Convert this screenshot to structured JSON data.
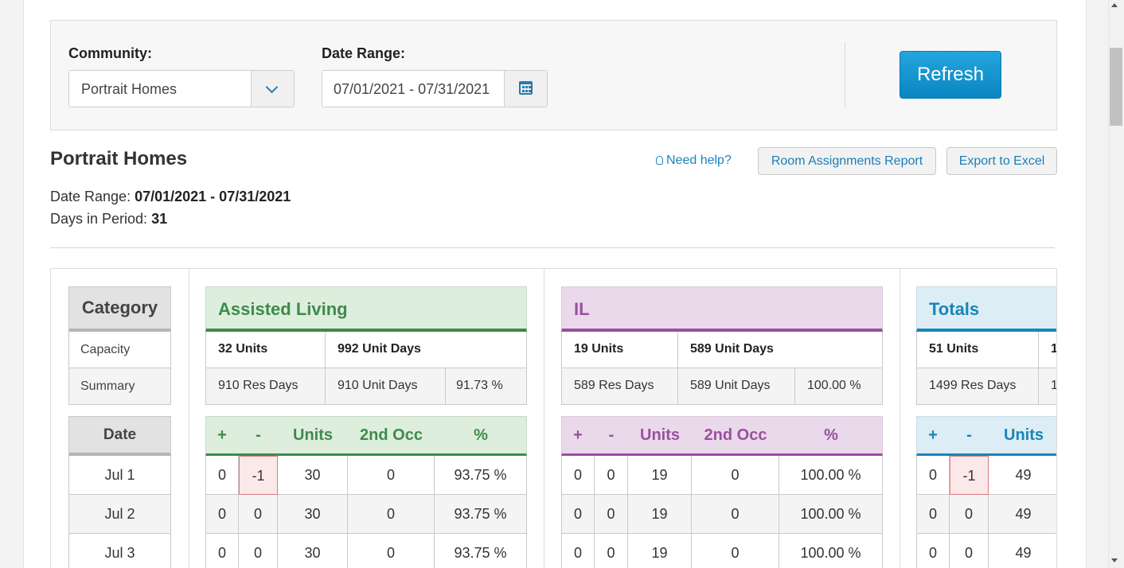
{
  "colors": {
    "accent": "#0b86c2",
    "al_green": "#3f8a4c",
    "il_purple": "#9a4fa0",
    "totals_teal": "#1a85b8",
    "negative_bg": "#fbe9ea"
  },
  "filters": {
    "community_label": "Community:",
    "community_value": "Portrait Homes",
    "date_range_label": "Date Range:",
    "date_range_value": "07/01/2021 - 07/31/2021",
    "refresh_label": "Refresh"
  },
  "header": {
    "title": "Portrait Homes",
    "help_link": "Need help?",
    "room_assignments_button": "Room Assignments Report",
    "export_button": "Export to Excel",
    "date_range_label": "Date Range:",
    "date_range_value": "07/01/2021 - 07/31/2021",
    "days_label": "Days in Period:",
    "days_value": "31"
  },
  "category": {
    "head": "Category",
    "rows": [
      "Capacity",
      "Summary"
    ],
    "date_head": "Date",
    "dates": [
      "Jul 1",
      "Jul 2",
      "Jul 3"
    ]
  },
  "sections": [
    {
      "title": "Assisted Living",
      "capacity_units": "32 Units",
      "capacity_unit_days": "992 Unit Days",
      "summary_res_days": "910 Res Days",
      "summary_unit_days": "910 Unit Days",
      "summary_pct": "91.73 %",
      "columns": [
        "+",
        "-",
        "Units",
        "2nd Occ",
        "%"
      ],
      "rows": [
        [
          "0",
          "-1",
          "30",
          "0",
          "93.75 %"
        ],
        [
          "0",
          "0",
          "30",
          "0",
          "93.75 %"
        ],
        [
          "0",
          "0",
          "30",
          "0",
          "93.75 %"
        ]
      ]
    },
    {
      "title": "IL",
      "capacity_units": "19 Units",
      "capacity_unit_days": "589 Unit Days",
      "summary_res_days": "589 Res Days",
      "summary_unit_days": "589 Unit Days",
      "summary_pct": "100.00 %",
      "columns": [
        "+",
        "-",
        "Units",
        "2nd Occ",
        "%"
      ],
      "rows": [
        [
          "0",
          "0",
          "19",
          "0",
          "100.00 %"
        ],
        [
          "0",
          "0",
          "19",
          "0",
          "100.00 %"
        ],
        [
          "0",
          "0",
          "19",
          "0",
          "100.00 %"
        ]
      ]
    },
    {
      "title": "Totals",
      "capacity_units": "51 Units",
      "capacity_unit_days": "1",
      "summary_res_days": "1499 Res Days",
      "summary_unit_days": "1",
      "columns": [
        "+",
        "-",
        "Units"
      ],
      "rows": [
        [
          "0",
          "-1",
          "49"
        ],
        [
          "0",
          "0",
          "49"
        ],
        [
          "0",
          "0",
          "49"
        ]
      ]
    }
  ]
}
